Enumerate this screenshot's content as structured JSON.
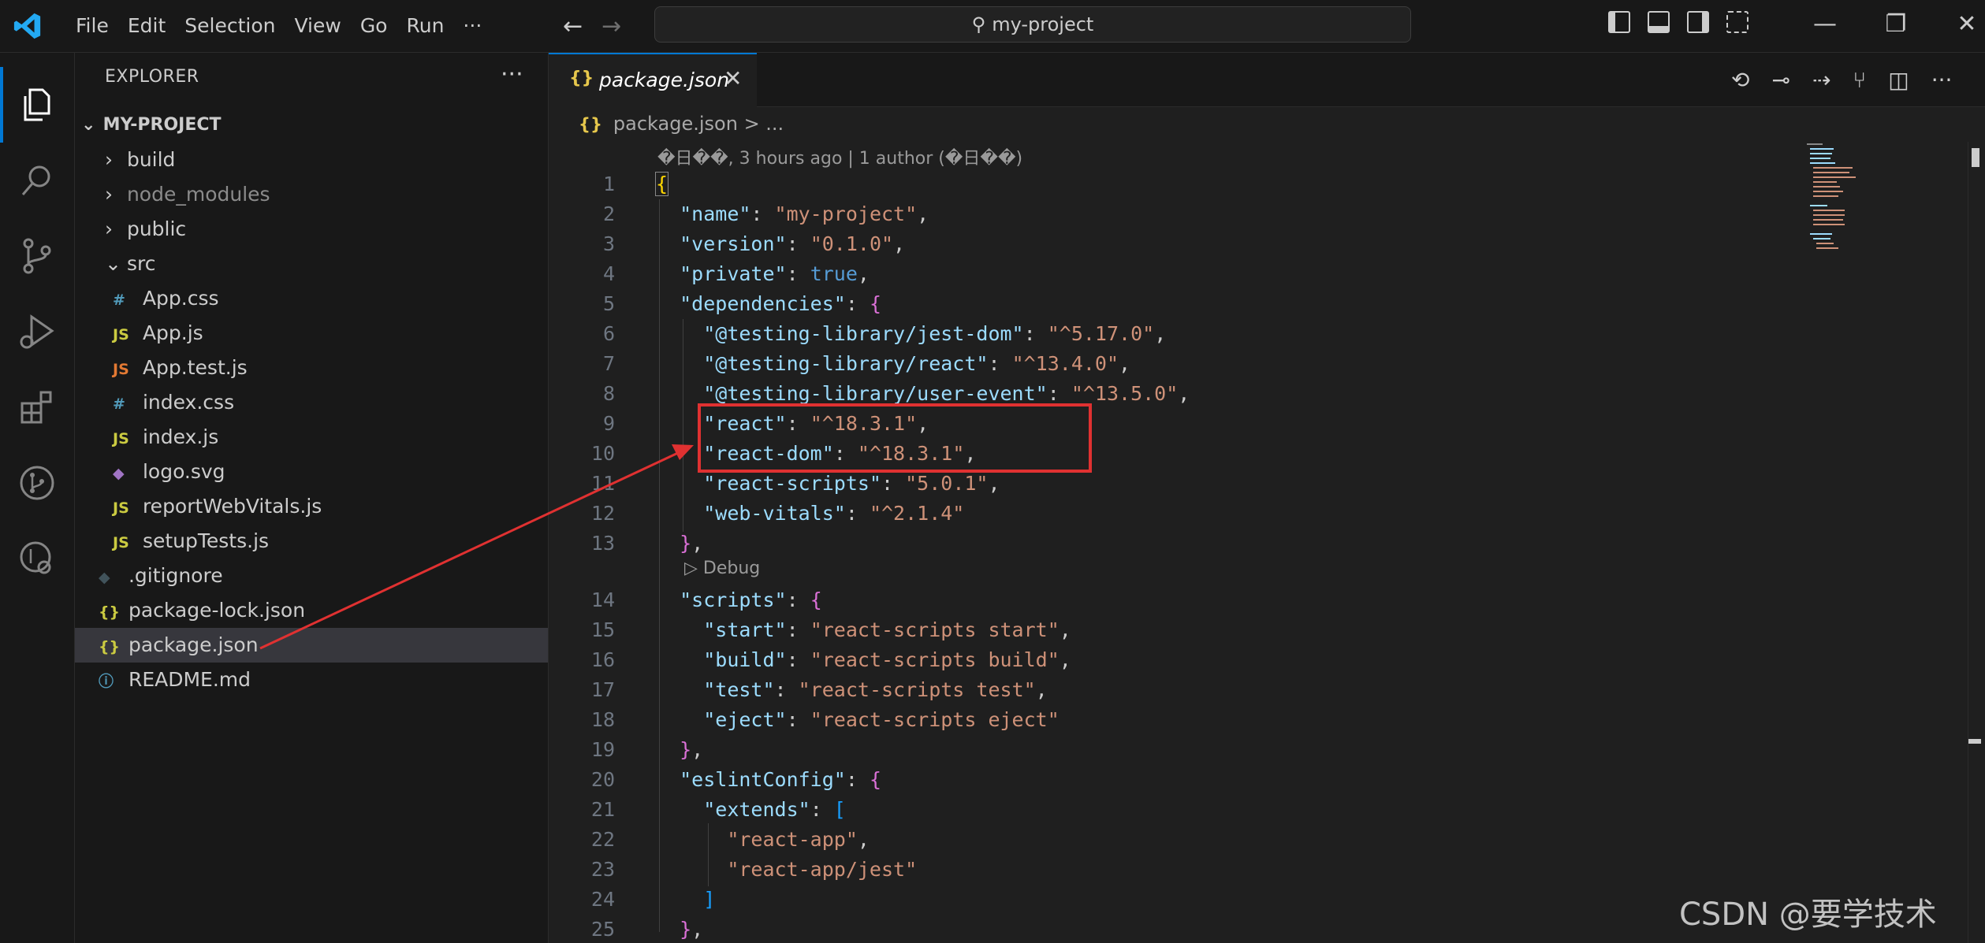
{
  "titlebar": {
    "menus": [
      "File",
      "Edit",
      "Selection",
      "View",
      "Go",
      "Run",
      "···"
    ],
    "search_text": "my-project",
    "colors": {
      "accent": "#0078d4"
    }
  },
  "activity_bar": {
    "icons": [
      "explorer-icon",
      "search-icon",
      "source-control-icon",
      "run-debug-icon",
      "extensions-icon",
      "git-graph-icon",
      "git-lens-icon"
    ]
  },
  "sidebar": {
    "title": "EXPLORER",
    "more": "···",
    "project_name": "MY-PROJECT",
    "items": [
      {
        "label": "build",
        "type": "folder",
        "indent": 1,
        "dim": false
      },
      {
        "label": "node_modules",
        "type": "folder",
        "indent": 1,
        "dim": true
      },
      {
        "label": "public",
        "type": "folder",
        "indent": 1,
        "dim": false
      },
      {
        "label": "src",
        "type": "folder-open",
        "indent": 1,
        "dim": false
      },
      {
        "label": "App.css",
        "type": "css",
        "icon": "#",
        "indent": 2
      },
      {
        "label": "App.js",
        "type": "js",
        "icon": "JS",
        "indent": 2
      },
      {
        "label": "App.test.js",
        "type": "jstest",
        "icon": "JS",
        "indent": 2
      },
      {
        "label": "index.css",
        "type": "css",
        "icon": "#",
        "indent": 2
      },
      {
        "label": "index.js",
        "type": "js",
        "icon": "JS",
        "indent": 2
      },
      {
        "label": "logo.svg",
        "type": "svg",
        "icon": "◆",
        "indent": 2
      },
      {
        "label": "reportWebVitals.js",
        "type": "js",
        "icon": "JS",
        "indent": 2
      },
      {
        "label": "setupTests.js",
        "type": "js",
        "icon": "JS",
        "indent": 2
      },
      {
        "label": ".gitignore",
        "type": "git",
        "icon": "◆",
        "indent": 1
      },
      {
        "label": "package-lock.json",
        "type": "json",
        "icon": "{}",
        "indent": 1
      },
      {
        "label": "package.json",
        "type": "json",
        "icon": "{}",
        "indent": 1,
        "selected": true
      },
      {
        "label": "README.md",
        "type": "info",
        "icon": "ⓘ",
        "indent": 1
      }
    ]
  },
  "editor": {
    "tab_label": "package.json",
    "tab_icon": "{}",
    "tab_close": "✕",
    "breadcrumb_file": "package.json",
    "breadcrumb_rest": "> ...",
    "blame": "�日��, 3 hours ago | 1 author (�日��)",
    "codelens": "Debug",
    "line_numbers": [
      "1",
      "2",
      "3",
      "4",
      "5",
      "6",
      "7",
      "8",
      "9",
      "10",
      "11",
      "12",
      "13",
      "14",
      "15",
      "16",
      "17",
      "18",
      "19",
      "20",
      "21",
      "22",
      "23",
      "24",
      "25"
    ]
  },
  "code": {
    "name_key": "\"name\"",
    "name_val": "\"my-project\"",
    "version_key": "\"version\"",
    "version_val": "\"0.1.0\"",
    "private_key": "\"private\"",
    "private_val": "true",
    "deps_key": "\"dependencies\"",
    "d1_key": "\"@testing-library/jest-dom\"",
    "d1_val": "\"^5.17.0\"",
    "d2_key": "\"@testing-library/react\"",
    "d2_val": "\"^13.4.0\"",
    "d3_key": "\"@testing-library/user-event\"",
    "d3_val": "\"^13.5.0\"",
    "d4_key": "\"react\"",
    "d4_val": "\"^18.3.1\"",
    "d5_key": "\"react-dom\"",
    "d5_val": "\"^18.3.1\"",
    "d6_key": "\"react-scripts\"",
    "d6_val": "\"5.0.1\"",
    "d7_key": "\"web-vitals\"",
    "d7_val": "\"^2.1.4\"",
    "scripts_key": "\"scripts\"",
    "s1_key": "\"start\"",
    "s1_val": "\"react-scripts start\"",
    "s2_key": "\"build\"",
    "s2_val": "\"react-scripts build\"",
    "s3_key": "\"test\"",
    "s3_val": "\"react-scripts test\"",
    "s4_key": "\"eject\"",
    "s4_val": "\"react-scripts eject\"",
    "eslint_key": "\"eslintConfig\"",
    "extends_key": "\"extends\"",
    "e1_val": "\"react-app\"",
    "e2_val": "\"react-app/jest\""
  },
  "watermark": "CSDN @要学技术"
}
